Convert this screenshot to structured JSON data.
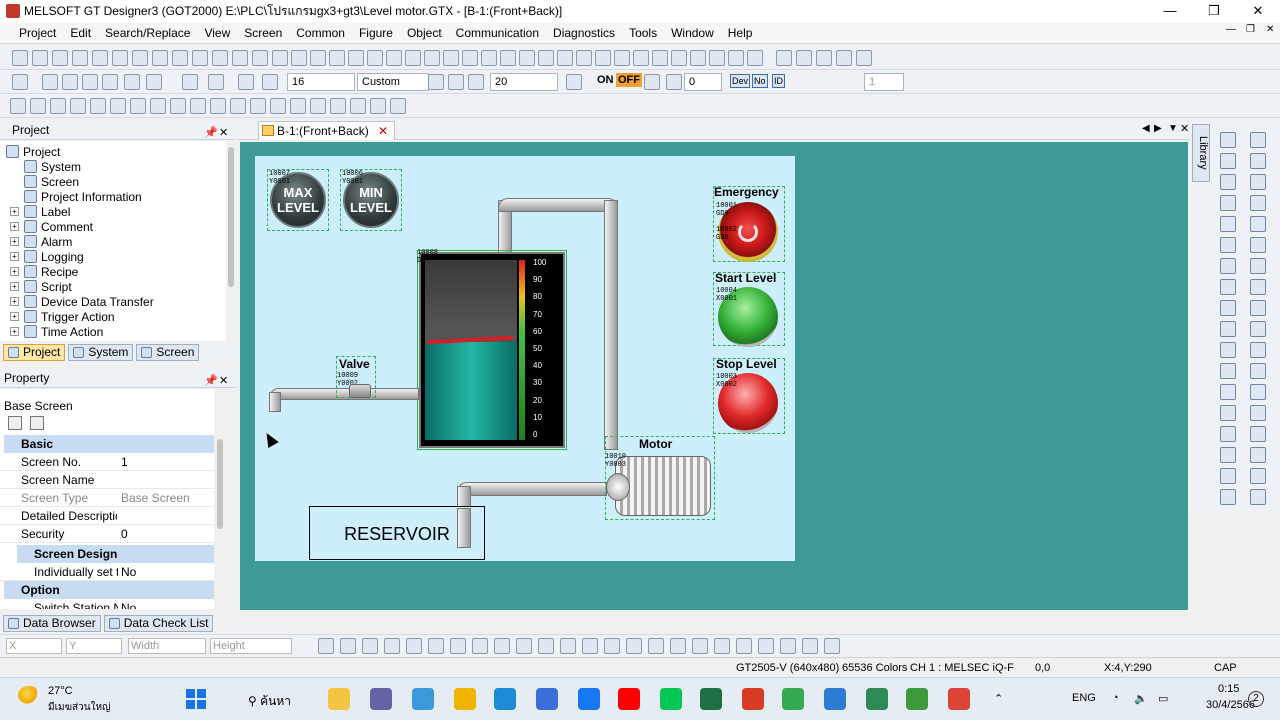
{
  "window": {
    "title": "MELSOFT GT Designer3 (GOT2000) E:\\PLC\\โปรแกรมgx3+gt3\\Level motor.GTX - [B-1:(Front+Back)]",
    "minimize": "—",
    "maximize": "❐",
    "close": "✕",
    "doc_min": "—",
    "doc_restore": "❐",
    "doc_close": "✕"
  },
  "menu": [
    "Project",
    "Edit",
    "Search/Replace",
    "View",
    "Screen",
    "Common",
    "Figure",
    "Object",
    "Communication",
    "Diagnostics",
    "Tools",
    "Window",
    "Help"
  ],
  "toolbar2": {
    "font_size": "16",
    "scale": "Custom",
    "grid": "20",
    "on_label": "ON",
    "off_label": "OFF",
    "value": "0",
    "dev_label": "Dev",
    "no_label": "No",
    "id_label": "ID",
    "layer": "1"
  },
  "project_panel": {
    "title": "Project",
    "tree": [
      {
        "label": "Project",
        "level": 0,
        "icon": "project-icon"
      },
      {
        "label": "System",
        "level": 1,
        "icon": "system-icon"
      },
      {
        "label": "Screen",
        "level": 1,
        "icon": "screen-icon"
      },
      {
        "label": "Project Information",
        "level": 1,
        "icon": "info-icon"
      },
      {
        "label": "Label",
        "level": 1,
        "icon": "label-icon"
      },
      {
        "label": "Comment",
        "level": 1,
        "icon": "comment-icon"
      },
      {
        "label": "Alarm",
        "level": 1,
        "icon": "alarm-icon"
      },
      {
        "label": "Logging",
        "level": 1,
        "icon": "logging-icon"
      },
      {
        "label": "Recipe",
        "level": 1,
        "icon": "recipe-icon"
      },
      {
        "label": "Script",
        "level": 1,
        "icon": "script-icon"
      },
      {
        "label": "Device Data Transfer",
        "level": 1,
        "icon": "transfer-icon"
      },
      {
        "label": "Trigger Action",
        "level": 1,
        "icon": "trigger-icon"
      },
      {
        "label": "Time Action",
        "level": 1,
        "icon": "time-icon"
      }
    ],
    "tabs": [
      "Project",
      "System",
      "Screen"
    ]
  },
  "property_panel": {
    "title": "Property",
    "object_type": "Base Screen",
    "categories": {
      "basic": "Basic",
      "screen_design": "Screen Design",
      "option": "Option"
    },
    "rows": {
      "screen_no": {
        "key": "Screen No.",
        "value": "1"
      },
      "screen_name": {
        "key": "Screen Name",
        "value": ""
      },
      "screen_type": {
        "key": "Screen Type",
        "value": "Base Screen"
      },
      "description": {
        "key": "Detailed Descriptio",
        "value": ""
      },
      "security": {
        "key": "Security",
        "value": "0"
      },
      "individually": {
        "key": "Individually set t",
        "value": "No"
      },
      "switch_station": {
        "key": "Switch Station N",
        "value": "No"
      }
    }
  },
  "editor": {
    "tab_label": "B-1:(Front+Back)",
    "tab_close": "✕",
    "library_label": "Library"
  },
  "hmi": {
    "max_lamp": {
      "line1": "MAX",
      "line2": "LEVEL",
      "device1": "10007",
      "device2": "Y0001"
    },
    "min_lamp": {
      "line1": "MIN",
      "line2": "LEVEL",
      "device1": "10006",
      "device2": "Y0001"
    },
    "tank": {
      "device1": "10008",
      "device2": "D0",
      "level_percent": 30,
      "scale": [
        "100",
        "90",
        "80",
        "70",
        "60",
        "50",
        "40",
        "30",
        "20",
        "10",
        "0"
      ]
    },
    "valve": {
      "label": "Valve",
      "device1": "10009",
      "device2": "Y0002"
    },
    "emergency": {
      "label": "Emergency",
      "device1": "10001",
      "device2": "GD0",
      "device3": "10002",
      "device4": "GD0"
    },
    "start": {
      "label": "Start Level",
      "device1": "10004",
      "device2": "X0001"
    },
    "stop": {
      "label": "Stop Level",
      "device1": "10003",
      "device2": "X0002"
    },
    "motor": {
      "label": "Motor",
      "device1": "10010",
      "device2": "Y0003"
    },
    "reservoir": "RESERVOIR"
  },
  "bottom_tabs": [
    "Data Browser",
    "Data Check List"
  ],
  "bottom_toolbar": {
    "x": "X",
    "y": "Y",
    "width": "Width",
    "height": "Height"
  },
  "status": {
    "got_type": "GT2505-V (640x480)",
    "colors": "65536 Colors",
    "channel": "CH 1 : MELSEC iQ-F",
    "coord": "0,0",
    "cursor": "X:4,Y:290",
    "caps": "CAP"
  },
  "taskbar": {
    "temp": "27°C",
    "weather": "มีเมฆส่วนใหญ่",
    "search": "ค้นหา",
    "lang": "ENG",
    "time": "0:15",
    "date": "30/4/2566",
    "notif": "2"
  },
  "colors": {
    "canvas": "#3e9a96",
    "hmi_bg": "#cdeefc",
    "accent": "#ffe8a6"
  }
}
